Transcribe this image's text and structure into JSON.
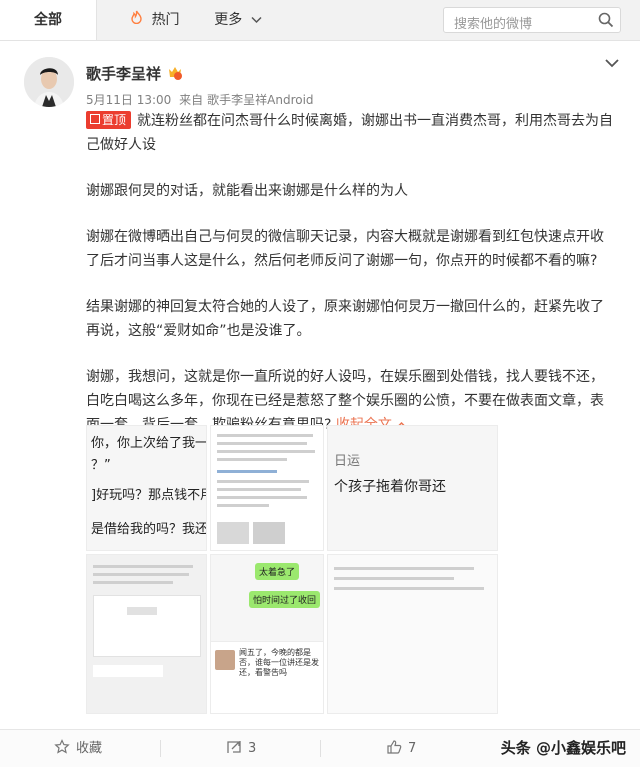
{
  "nav": {
    "tabs": [
      {
        "label": "全部",
        "icon": "none"
      },
      {
        "label": "热门",
        "icon": "fire-icon"
      },
      {
        "label": "更多",
        "icon": "chevron-down-icon"
      }
    ],
    "search_placeholder": "搜索他的微博"
  },
  "post": {
    "author": "歌手李呈祥",
    "date": "5月11日 13:00",
    "source_prefix": "来自",
    "source": "歌手李呈祥Android",
    "pinned_label": "置顶",
    "paragraphs": [
      "就连粉丝都在问杰哥什么时候离婚，谢娜出书一直消费杰哥，利用杰哥去为自己做好人设",
      "谢娜跟何炅的对话，就能看出来谢娜是什么样的为人",
      "谢娜在微博晒出自己与何炅的微信聊天记录，内容大概就是谢娜看到红包快速点开收了后才问当事人这是什么，然后何老师反问了谢娜一句，你点开的时候都不看的嘛?",
      "结果谢娜的神回复太符合她的人设了，原来谢娜怕何炅万一撤回什么的，赶紧先收了再说，这般“爱财如命”也是没谁了。",
      "谢娜，我想问，这就是你一直所说的好人设吗，在娱乐圈到处借钱，找人要钱不还，白吃白喝这么多年，你现在已经是惹怒了整个娱乐圈的公愤，不要在做表面文章，表面一套，背后一套，欺骗粉丝有意思吗?"
    ],
    "collapse_label": "收起全文",
    "images": {
      "img1_lines": [
        "你，你上次给了我一点钱",
        "？”",
        "]好玩吗？那点钱不用还",
        "是借给我的吗？我还以"
      ],
      "img3_lines": [
        "日运",
        "个孩子拖着你哥还"
      ],
      "img5_bubbles": [
        "太着急了",
        "怕时间过了收回"
      ],
      "img6_caption": "闻五了，今晚的都是否，谁每一位讲还是发还，看警告吗"
    }
  },
  "footer": {
    "favorite_label": "收藏",
    "repost_count": "3",
    "comment_count": "",
    "like_count": "7",
    "watermark": "头条 @小鑫娱乐吧"
  }
}
